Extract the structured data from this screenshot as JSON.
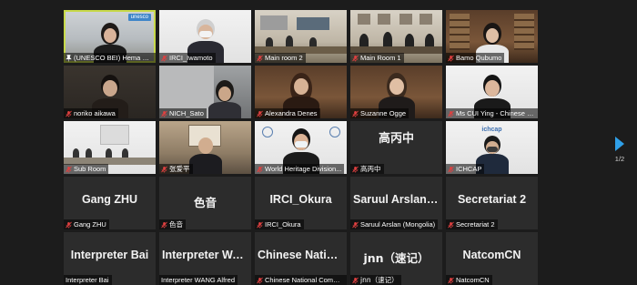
{
  "pagination": {
    "current": "1/2"
  },
  "colors": {
    "active_border": "#c7d94a",
    "muted_mic": "#e04040",
    "page_arrow": "#2f9fe8"
  },
  "tiles": [
    {
      "label": "(UNESCO BEI) Hema Gur...",
      "logo": "unesco",
      "pinned": true
    },
    {
      "label": "IRCI_Iwamoto"
    },
    {
      "label": "Main room 2"
    },
    {
      "label": "Main Room 1"
    },
    {
      "label": "Bamo Qubumo"
    },
    {
      "label": "noriko aikawa"
    },
    {
      "label": "NICH_Sato"
    },
    {
      "label": "Alexandra Denes"
    },
    {
      "label": "Suzanne Ogge"
    },
    {
      "label": "Ms CUI Ying - Chinese Na..."
    },
    {
      "label": "Sub Room"
    },
    {
      "label": "张爱平"
    },
    {
      "label": "World Heritage Division..."
    },
    {
      "label": "高丙中",
      "big": "高丙中"
    },
    {
      "label": "ICHCAP",
      "logo": "ichcap"
    },
    {
      "label": "Gang ZHU",
      "big": "Gang ZHU"
    },
    {
      "label": "色音",
      "big": "色音"
    },
    {
      "label": "IRCI_Okura",
      "big": "IRCI_Okura"
    },
    {
      "label": "Saruul Arslan (Mongolia)",
      "big": "Saruul Arslan (..."
    },
    {
      "label": "Secretariat 2",
      "big": "Secretariat 2"
    },
    {
      "label": "Interpreter Bai",
      "big": "Interpreter Bai"
    },
    {
      "label": "Interpreter WANG Alfred",
      "big": "Interpreter WA..."
    },
    {
      "label": "Chinese National Commi...",
      "big": "Chinese Nation..."
    },
    {
      "label": "jnn（速记）",
      "big": "jnn（速记）"
    },
    {
      "label": "NatcomCN",
      "big": "NatcomCN"
    }
  ],
  "logos": {
    "unesco": "unesco",
    "ichcap": "ichcap"
  }
}
